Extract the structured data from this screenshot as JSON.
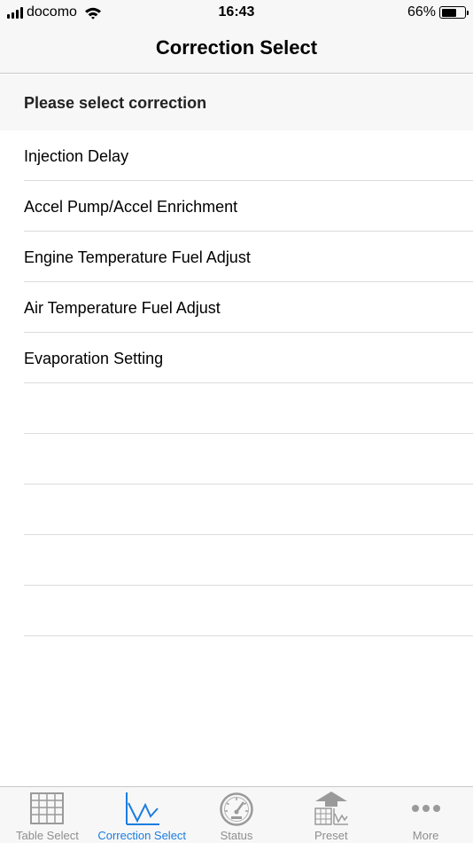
{
  "status_bar": {
    "carrier": "docomo",
    "time": "16:43",
    "battery_percent": "66%",
    "battery_level": 0.66
  },
  "nav": {
    "title": "Correction Select"
  },
  "section": {
    "header": "Please select correction"
  },
  "list": {
    "items": [
      {
        "label": "Injection Delay"
      },
      {
        "label": "Accel Pump/Accel Enrichment"
      },
      {
        "label": "Engine Temperature Fuel Adjust"
      },
      {
        "label": "Air Temperature Fuel Adjust"
      },
      {
        "label": "Evaporation Setting"
      }
    ]
  },
  "tabs": [
    {
      "label": "Table Select",
      "icon": "grid-table-icon",
      "active": false
    },
    {
      "label": "Correction Select",
      "icon": "line-chart-icon",
      "active": true
    },
    {
      "label": "Status",
      "icon": "speedometer-icon",
      "active": false
    },
    {
      "label": "Preset",
      "icon": "preset-upload-icon",
      "active": false
    },
    {
      "label": "More",
      "icon": "more-dots-icon",
      "active": false
    }
  ],
  "colors": {
    "accent": "#1a7de0",
    "inactive": "#8e8e8e",
    "bar_background": "#f7f7f7"
  }
}
